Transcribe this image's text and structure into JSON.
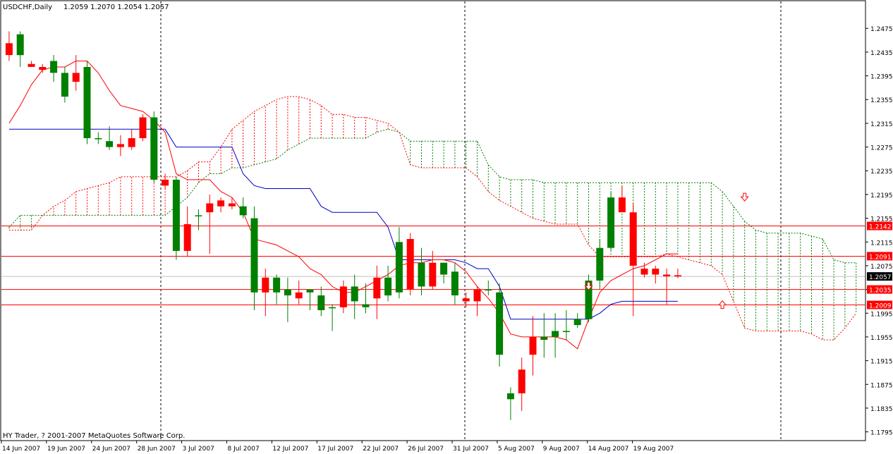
{
  "header": {
    "symbol_label": "USDCHF,Daily",
    "ohlc_label": "1.2059 1.2070 1.2054 1.2057"
  },
  "footer": {
    "copyright": "HY Trader, ? 2001-2007 MetaQuotes Software Corp."
  },
  "price_axis": {
    "ticks": [
      "1.2475",
      "1.2435",
      "1.2395",
      "1.2355",
      "1.2315",
      "1.2275",
      "1.2235",
      "1.2195",
      "1.2155",
      "1.2115",
      "1.2075",
      "1.2035",
      "1.1995",
      "1.1955",
      "1.1915",
      "1.1875",
      "1.1835",
      "1.1795"
    ]
  },
  "time_axis": {
    "ticks": [
      "14 Jun 2007",
      "19 Jun 2007",
      "24 Jun 2007",
      "28 Jun 2007",
      "3 Jul 2007",
      "8 Jul 2007",
      "12 Jul 2007",
      "17 Jul 2007",
      "22 Jul 2007",
      "26 Jul 2007",
      "31 Jul 2007",
      "5 Aug 2007",
      "9 Aug 2007",
      "14 Aug 2007",
      "19 Aug 2007"
    ]
  },
  "horizontal_levels": [
    {
      "label": "1.2142",
      "value": 1.2142
    },
    {
      "label": "1.2091",
      "value": 1.2091
    },
    {
      "label": "1.2035",
      "value": 1.2035
    },
    {
      "label": "1.2009",
      "value": 1.2009
    }
  ],
  "current_price": {
    "label": "1.2057",
    "value": 1.2057
  },
  "colors": {
    "background": "#ffffff",
    "bull": "#008000",
    "bear": "#ff0000",
    "kijun": "#0000c0",
    "tenkan": "#ff0000",
    "cloud_up": "#008000",
    "cloud_down": "#ff0000",
    "level_line": "#ff0000",
    "current_label_bg": "#000000"
  },
  "chart_data": {
    "type": "candlestick",
    "y_range": [
      1.1785,
      1.2505
    ],
    "candles": [
      {
        "o": 1.245,
        "h": 1.247,
        "l": 1.242,
        "c": 1.243
      },
      {
        "o": 1.243,
        "h": 1.247,
        "l": 1.241,
        "c": 1.2465
      },
      {
        "o": 1.2415,
        "h": 1.242,
        "l": 1.241,
        "c": 1.241
      },
      {
        "o": 1.241,
        "h": 1.2415,
        "l": 1.24,
        "c": 1.2405
      },
      {
        "o": 1.24,
        "h": 1.243,
        "l": 1.2385,
        "c": 1.242
      },
      {
        "o": 1.236,
        "h": 1.241,
        "l": 1.235,
        "c": 1.24
      },
      {
        "o": 1.24,
        "h": 1.243,
        "l": 1.237,
        "c": 1.2385
      },
      {
        "o": 1.229,
        "h": 1.242,
        "l": 1.228,
        "c": 1.241
      },
      {
        "o": 1.229,
        "h": 1.23,
        "l": 1.228,
        "c": 1.229
      },
      {
        "o": 1.2275,
        "h": 1.231,
        "l": 1.227,
        "c": 1.2285
      },
      {
        "o": 1.228,
        "h": 1.2295,
        "l": 1.226,
        "c": 1.2275
      },
      {
        "o": 1.229,
        "h": 1.2305,
        "l": 1.227,
        "c": 1.2275
      },
      {
        "o": 1.2325,
        "h": 1.233,
        "l": 1.2285,
        "c": 1.229
      },
      {
        "o": 1.222,
        "h": 1.2335,
        "l": 1.2215,
        "c": 1.2325
      },
      {
        "o": 1.222,
        "h": 1.223,
        "l": 1.2205,
        "c": 1.221
      },
      {
        "o": 1.21,
        "h": 1.2225,
        "l": 1.2085,
        "c": 1.222
      },
      {
        "o": 1.2145,
        "h": 1.2175,
        "l": 1.209,
        "c": 1.21
      },
      {
        "o": 1.216,
        "h": 1.217,
        "l": 1.2135,
        "c": 1.216
      },
      {
        "o": 1.218,
        "h": 1.2195,
        "l": 1.2095,
        "c": 1.2165
      },
      {
        "o": 1.2185,
        "h": 1.219,
        "l": 1.2165,
        "c": 1.2175
      },
      {
        "o": 1.218,
        "h": 1.219,
        "l": 1.217,
        "c": 1.2175
      },
      {
        "o": 1.216,
        "h": 1.219,
        "l": 1.2155,
        "c": 1.2175
      },
      {
        "o": 1.203,
        "h": 1.2175,
        "l": 1.2,
        "c": 1.2155
      },
      {
        "o": 1.2055,
        "h": 1.207,
        "l": 1.199,
        "c": 1.203
      },
      {
        "o": 1.203,
        "h": 1.206,
        "l": 1.201,
        "c": 1.2055
      },
      {
        "o": 1.2025,
        "h": 1.2055,
        "l": 1.198,
        "c": 1.2035
      },
      {
        "o": 1.203,
        "h": 1.205,
        "l": 1.201,
        "c": 1.202
      },
      {
        "o": 1.203,
        "h": 1.2035,
        "l": 1.2,
        "c": 1.2035
      },
      {
        "o": 1.2,
        "h": 1.204,
        "l": 1.199,
        "c": 1.2025
      },
      {
        "o": 1.2005,
        "h": 1.201,
        "l": 1.1965,
        "c": 1.2005
      },
      {
        "o": 1.204,
        "h": 1.205,
        "l": 1.1995,
        "c": 1.2005
      },
      {
        "o": 1.2015,
        "h": 1.206,
        "l": 1.1985,
        "c": 1.204
      },
      {
        "o": 1.2005,
        "h": 1.2045,
        "l": 1.1995,
        "c": 1.201
      },
      {
        "o": 1.2055,
        "h": 1.2075,
        "l": 1.1985,
        "c": 1.202
      },
      {
        "o": 1.2025,
        "h": 1.2075,
        "l": 1.2015,
        "c": 1.2055
      },
      {
        "o": 1.203,
        "h": 1.214,
        "l": 1.202,
        "c": 1.2115
      },
      {
        "o": 1.212,
        "h": 1.213,
        "l": 1.2025,
        "c": 1.2035
      },
      {
        "o": 1.204,
        "h": 1.2105,
        "l": 1.2025,
        "c": 1.208
      },
      {
        "o": 1.208,
        "h": 1.21,
        "l": 1.2035,
        "c": 1.204
      },
      {
        "o": 1.206,
        "h": 1.208,
        "l": 1.2045,
        "c": 1.208
      },
      {
        "o": 1.2025,
        "h": 1.208,
        "l": 1.201,
        "c": 1.2065
      },
      {
        "o": 1.202,
        "h": 1.203,
        "l": 1.2005,
        "c": 1.2015
      },
      {
        "o": 1.2035,
        "h": 1.204,
        "l": 1.199,
        "c": 1.2015
      },
      {
        "o": 1.2035,
        "h": 1.205,
        "l": 1.2025,
        "c": 1.2035
      },
      {
        "o": 1.1925,
        "h": 1.2045,
        "l": 1.1905,
        "c": 1.203
      },
      {
        "o": 1.185,
        "h": 1.187,
        "l": 1.1815,
        "c": 1.186
      },
      {
        "o": 1.19,
        "h": 1.192,
        "l": 1.183,
        "c": 1.186
      },
      {
        "o": 1.1955,
        "h": 1.199,
        "l": 1.189,
        "c": 1.1925
      },
      {
        "o": 1.195,
        "h": 1.1995,
        "l": 1.192,
        "c": 1.1955
      },
      {
        "o": 1.1955,
        "h": 1.1995,
        "l": 1.192,
        "c": 1.1965
      },
      {
        "o": 1.1965,
        "h": 1.2,
        "l": 1.195,
        "c": 1.1965
      },
      {
        "o": 1.1975,
        "h": 1.1995,
        "l": 1.197,
        "c": 1.1985
      },
      {
        "o": 1.1985,
        "h": 1.206,
        "l": 1.198,
        "c": 1.205
      },
      {
        "o": 1.205,
        "h": 1.212,
        "l": 1.2035,
        "c": 1.2105
      },
      {
        "o": 1.2105,
        "h": 1.22,
        "l": 1.21,
        "c": 1.219
      },
      {
        "o": 1.219,
        "h": 1.221,
        "l": 1.2165,
        "c": 1.2165
      },
      {
        "o": 1.2165,
        "h": 1.218,
        "l": 1.199,
        "c": 1.2075
      },
      {
        "o": 1.207,
        "h": 1.208,
        "l": 1.2055,
        "c": 1.206
      },
      {
        "o": 1.207,
        "h": 1.2075,
        "l": 1.2045,
        "c": 1.206
      },
      {
        "o": 1.206,
        "h": 1.207,
        "l": 1.201,
        "c": 1.2057
      },
      {
        "o": 1.2059,
        "h": 1.207,
        "l": 1.2054,
        "c": 1.2057
      }
    ],
    "tenkan": [
      1.2315,
      1.2345,
      1.238,
      1.2405,
      1.241,
      1.241,
      1.242,
      1.242,
      1.24,
      1.237,
      1.2345,
      1.234,
      1.2335,
      1.232,
      1.23,
      1.223,
      1.222,
      1.222,
      1.222,
      1.22,
      1.219,
      1.2165,
      1.212,
      1.2115,
      1.211,
      1.21,
      1.209,
      1.207,
      1.206,
      1.204,
      1.203,
      1.203,
      1.204,
      1.205,
      1.206,
      1.2075,
      1.208,
      1.208,
      1.2085,
      1.2085,
      1.208,
      1.2065,
      1.204,
      1.202,
      1.1995,
      1.196,
      1.1955,
      1.1955,
      1.1955,
      1.1955,
      1.195,
      1.1935,
      1.1985,
      1.203,
      1.205,
      1.206,
      1.207,
      1.2075,
      1.2085,
      1.2095,
      1.2095
    ],
    "kijun": [
      1.2305,
      1.2305,
      1.2305,
      1.2305,
      1.2305,
      1.2305,
      1.2305,
      1.2305,
      1.2305,
      1.2305,
      1.2305,
      1.2305,
      1.2305,
      1.2305,
      1.2305,
      1.2275,
      1.2275,
      1.2275,
      1.2275,
      1.2275,
      1.2275,
      1.223,
      1.221,
      1.2205,
      1.2205,
      1.2205,
      1.2205,
      1.2205,
      1.2175,
      1.2165,
      1.2165,
      1.2165,
      1.2165,
      1.2165,
      1.214,
      1.2085,
      1.2085,
      1.2085,
      1.2085,
      1.2085,
      1.2085,
      1.208,
      1.207,
      1.207,
      1.204,
      1.1985,
      1.1985,
      1.1985,
      1.1985,
      1.1985,
      1.1985,
      1.1985,
      1.1985,
      1.1995,
      1.201,
      1.2015,
      1.2015,
      1.2015,
      1.2015,
      1.2015,
      1.2015
    ],
    "cloud": {
      "start_index": 0,
      "span_a": [
        1.214,
        1.216,
        1.216,
        1.216,
        1.216,
        1.216,
        1.216,
        1.216,
        1.216,
        1.216,
        1.216,
        1.216,
        1.216,
        1.216,
        1.216,
        1.2175,
        1.219,
        1.2215,
        1.223,
        1.223,
        1.224,
        1.224,
        1.2245,
        1.225,
        1.2255,
        1.227,
        1.228,
        1.229,
        1.229,
        1.229,
        1.229,
        1.229,
        1.229,
        1.23,
        1.2305,
        1.23,
        1.2285,
        1.2285,
        1.2285,
        1.2285,
        1.2285,
        1.2285,
        1.2285,
        1.2245,
        1.2225,
        1.222,
        1.222,
        1.222,
        1.2215,
        1.2215,
        1.2215,
        1.2215,
        1.2215,
        1.2215,
        1.2215,
        1.2215,
        1.2215,
        1.2215,
        1.2215,
        1.2215,
        1.2215,
        1.2215,
        1.2215,
        1.2215,
        1.22,
        1.2175,
        1.215,
        1.2135,
        1.213,
        1.213,
        1.213,
        1.213,
        1.2125,
        1.212,
        1.2085,
        1.208,
        1.208,
        1.208,
        1.208,
        1.208
      ],
      "span_b": [
        1.2135,
        1.2135,
        1.2135,
        1.216,
        1.2175,
        1.2185,
        1.22,
        1.2205,
        1.221,
        1.2215,
        1.2225,
        1.2225,
        1.2225,
        1.2225,
        1.2225,
        1.2225,
        1.2235,
        1.225,
        1.225,
        1.2275,
        1.2305,
        1.232,
        1.2335,
        1.2345,
        1.2355,
        1.236,
        1.236,
        1.2355,
        1.2345,
        1.233,
        1.233,
        1.2325,
        1.2325,
        1.232,
        1.2315,
        1.23,
        1.2245,
        1.224,
        1.224,
        1.224,
        1.224,
        1.224,
        1.2225,
        1.22,
        1.2185,
        1.2175,
        1.2165,
        1.2155,
        1.215,
        1.2145,
        1.2145,
        1.2145,
        1.211,
        1.209,
        1.209,
        1.209,
        1.209,
        1.209,
        1.209,
        1.2095,
        1.209,
        1.2085,
        1.208,
        1.2075,
        1.206,
        1.2015,
        1.197,
        1.1965,
        1.1965,
        1.1965,
        1.1965,
        1.1965,
        1.196,
        1.195,
        1.195,
        1.197,
        1.1995,
        1.2015,
        1.203,
        1.2045
      ]
    },
    "markers": [
      {
        "type": "arrow-down",
        "index": 52,
        "value": 1.204,
        "color": "#ff0000"
      },
      {
        "type": "arrow-down",
        "index": 66,
        "value": 1.219,
        "color": "#ff0000"
      },
      {
        "type": "arrow-up",
        "index": 64,
        "value": 1.201,
        "color": "#ff0000"
      }
    ]
  }
}
